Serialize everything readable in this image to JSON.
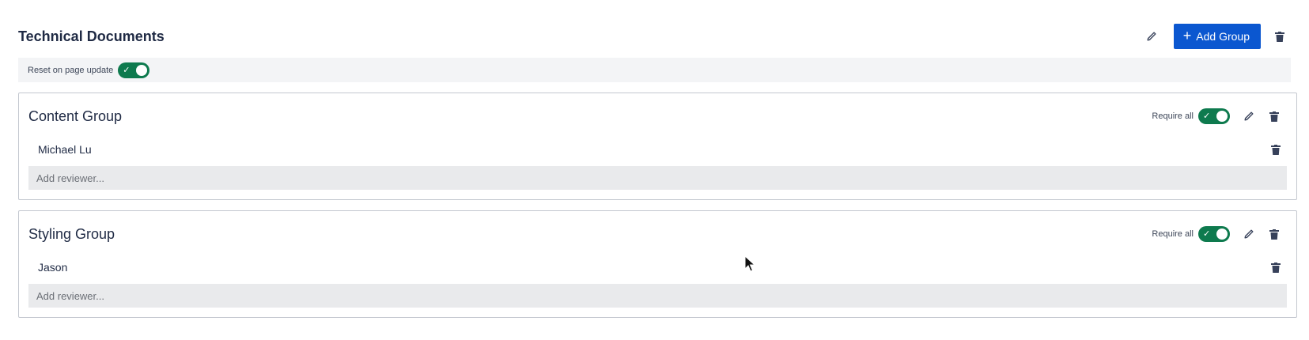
{
  "header": {
    "title": "Technical Documents",
    "add_group_label": "Add Group"
  },
  "reset": {
    "label": "Reset on page update",
    "enabled": true
  },
  "groups": [
    {
      "title": "Content Group",
      "require_all_label": "Require all",
      "require_all": true,
      "reviewers": [
        "Michael Lu"
      ],
      "add_reviewer_placeholder": "Add reviewer..."
    },
    {
      "title": "Styling Group",
      "require_all_label": "Require all",
      "require_all": true,
      "reviewers": [
        "Jason"
      ],
      "add_reviewer_placeholder": "Add reviewer..."
    }
  ],
  "colors": {
    "primary": "#0b57d0",
    "toggle_on": "#0e7a4e",
    "text": "#1f2a44"
  },
  "icons": [
    "pencil-icon",
    "plus-icon",
    "trash-icon",
    "check-icon",
    "mouse-pointer-icon"
  ]
}
